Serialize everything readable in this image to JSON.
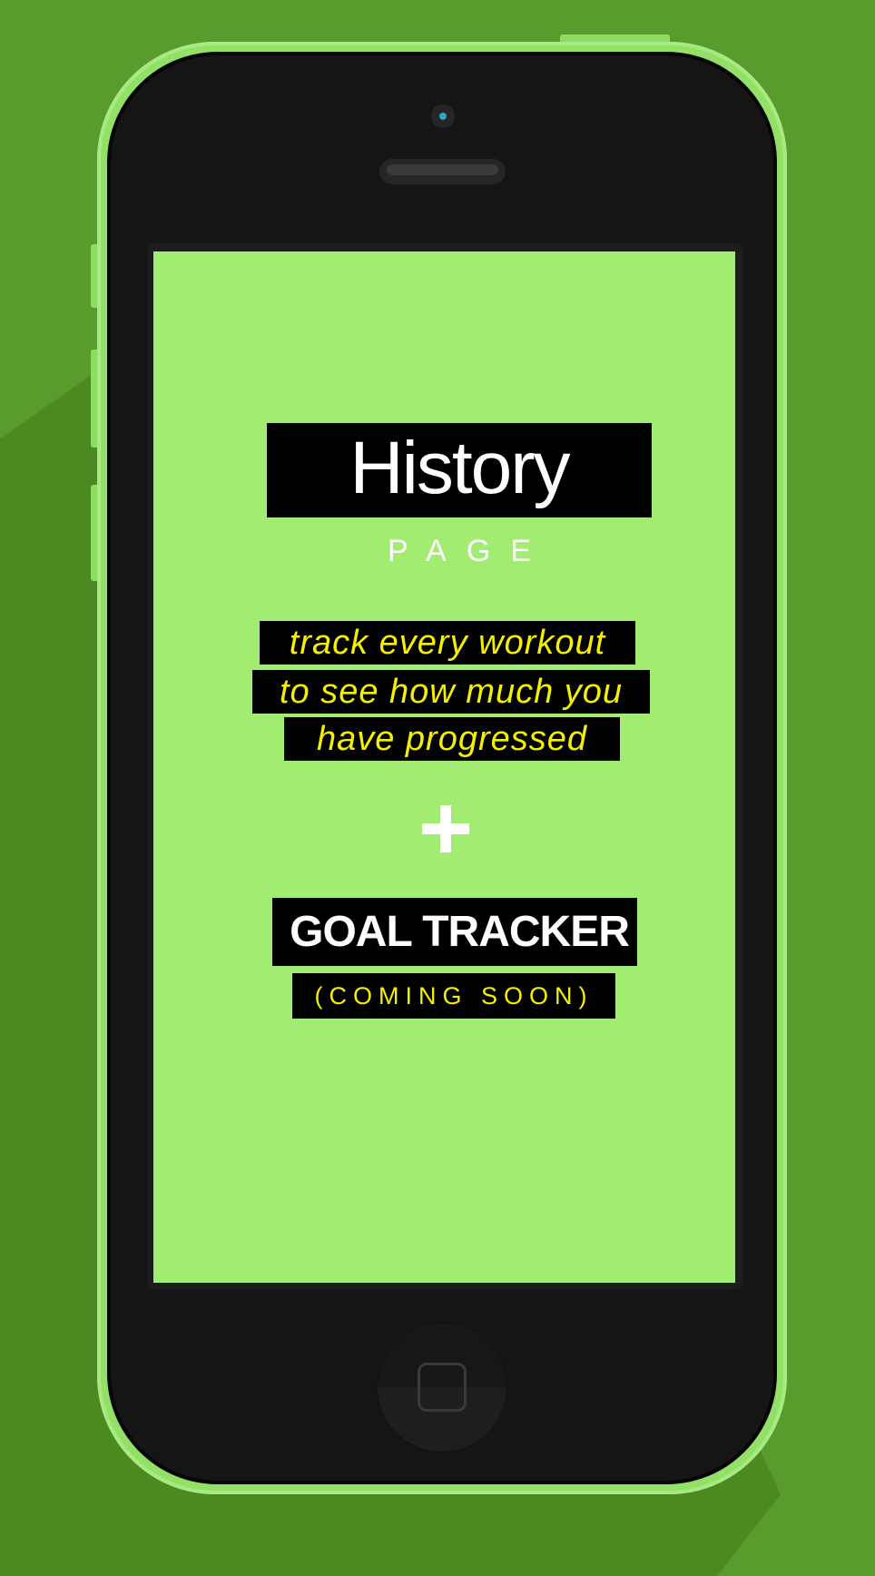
{
  "screen": {
    "title": "History",
    "subtitle": "PAGE",
    "tagline": [
      "track every workout",
      "to see how much you",
      "have progressed"
    ],
    "plus_icon": "plus-icon",
    "goal_title": "GOAL TRACKER",
    "goal_status": "(COMING SOON)"
  },
  "colors": {
    "background": "#5a9b2e",
    "phone_body": "#93e066",
    "screen": "#a1ec71",
    "highlight_text": "#f5f000"
  }
}
